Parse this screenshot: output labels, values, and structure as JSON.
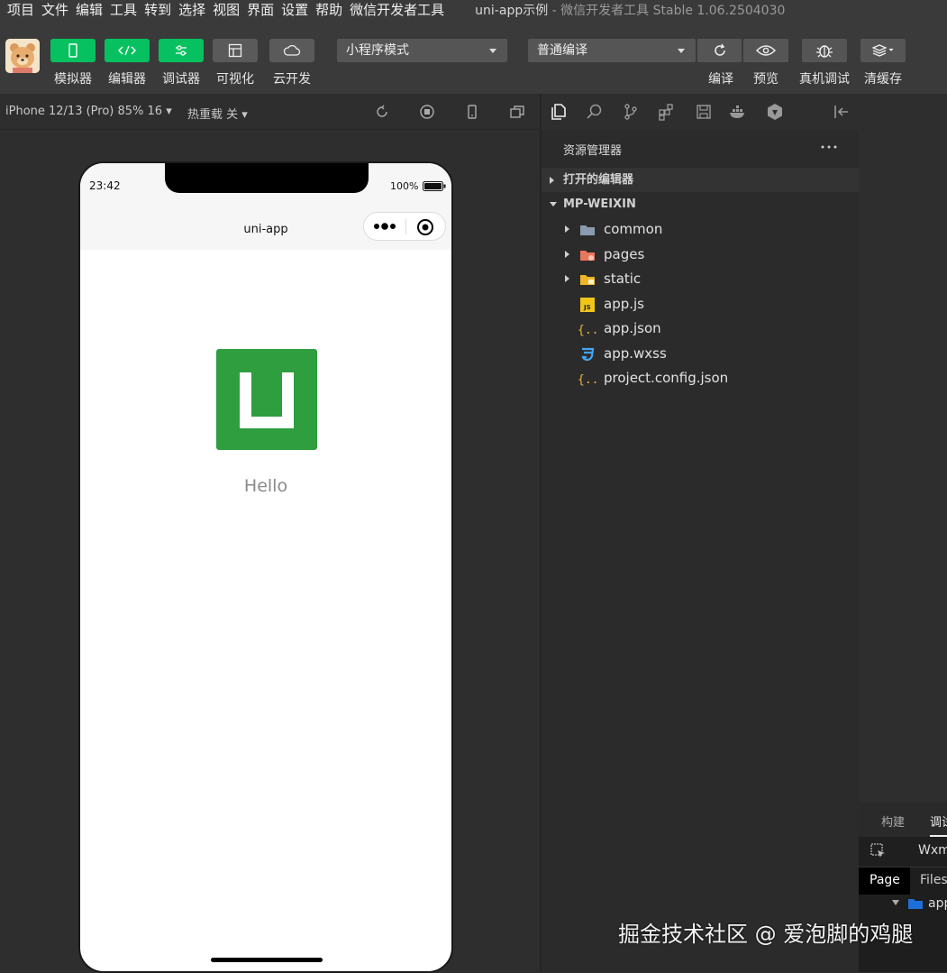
{
  "menu": [
    "项目",
    "文件",
    "编辑",
    "工具",
    "转到",
    "选择",
    "视图",
    "界面",
    "设置",
    "帮助",
    "微信开发者工具"
  ],
  "window_title": "uni-app示例",
  "window_subtitle": " - 微信开发者工具 Stable 1.06.2504030",
  "toolbar": {
    "left_buttons": [
      {
        "label": "模拟器",
        "icon": "phone-icon"
      },
      {
        "label": "编辑器",
        "icon": "code-icon"
      },
      {
        "label": "调试器",
        "icon": "debug-sliders-icon"
      },
      {
        "label": "可视化",
        "icon": "layout-icon"
      },
      {
        "label": "云开发",
        "icon": "cloud-icon"
      }
    ],
    "mode_select": "小程序模式",
    "compile_select": "普通编译",
    "right_buttons": [
      {
        "label": "编译",
        "icon": "refresh-icon"
      },
      {
        "label": "预览",
        "icon": "eye-icon"
      },
      {
        "label": "真机调试",
        "icon": "bug-icon"
      },
      {
        "label": "清缓存",
        "icon": "layers-icon"
      }
    ]
  },
  "simulator": {
    "device": "iPhone 12/13 (Pro) 85% 16",
    "hot_reload": "热重载 关",
    "status_time": "23:42",
    "battery": "100%",
    "nav_title": "uni-app",
    "hello_text": "Hello"
  },
  "explorer": {
    "title": "资源管理器",
    "open_editors": "打开的编辑器",
    "project": "MP-WEIXIN",
    "items": [
      {
        "name": "common",
        "type": "folder"
      },
      {
        "name": "pages",
        "type": "folder"
      },
      {
        "name": "static",
        "type": "folder"
      },
      {
        "name": "app.js",
        "type": "js"
      },
      {
        "name": "app.json",
        "type": "json"
      },
      {
        "name": "app.wxss",
        "type": "css"
      },
      {
        "name": "project.config.json",
        "type": "json"
      }
    ]
  },
  "bottom_panel": {
    "tab_build": "构建",
    "tab_debug": "调试",
    "wxml": "Wxml",
    "page_tab": "Page",
    "files_tab": "Files",
    "tree_item": "app"
  },
  "watermark": "掘金技术社区 @ 爱泡脚的鸡腿",
  "colors": {
    "accent": "#07c160",
    "logo_green": "#2e9e3e"
  }
}
